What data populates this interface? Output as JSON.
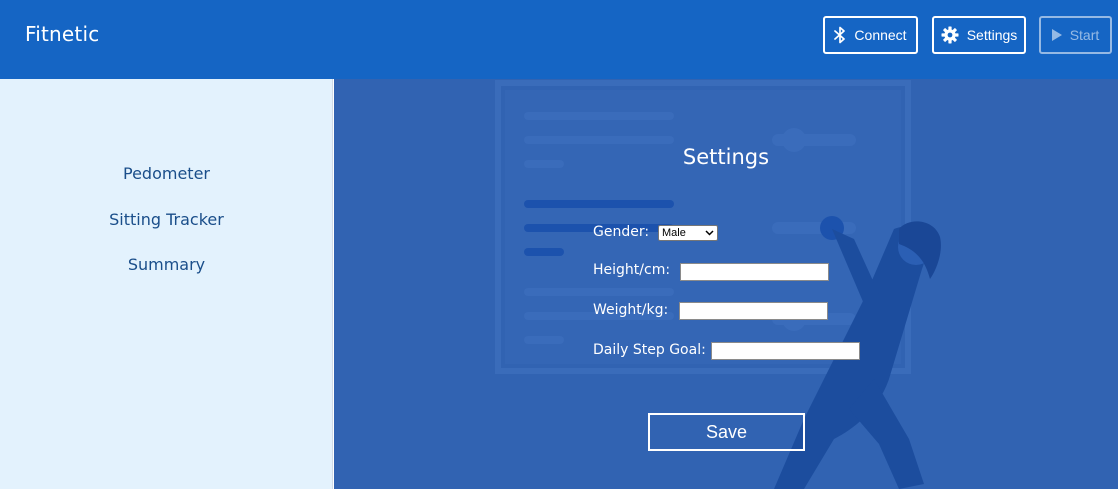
{
  "header": {
    "brand": "Fitnetic",
    "connect_label": "Connect",
    "settings_label": "Settings",
    "start_label": "Start",
    "start_enabled": false
  },
  "sidebar": {
    "items": [
      {
        "label": "Pedometer"
      },
      {
        "label": "Sitting Tracker"
      },
      {
        "label": "Summary"
      }
    ]
  },
  "settings_form": {
    "title": "Settings",
    "gender_label": "Gender:",
    "gender_value": "Male",
    "height_label": "Height/cm:",
    "height_value": "",
    "weight_label": "Weight/kg:",
    "weight_value": "",
    "goal_label": "Daily Step Goal:",
    "goal_value": "",
    "save_label": "Save"
  },
  "colors": {
    "header_bg": "#1565c4",
    "sidebar_bg": "#e3f2fd",
    "main_bg": "#3163b2",
    "nav_text": "#1a4e8a"
  }
}
